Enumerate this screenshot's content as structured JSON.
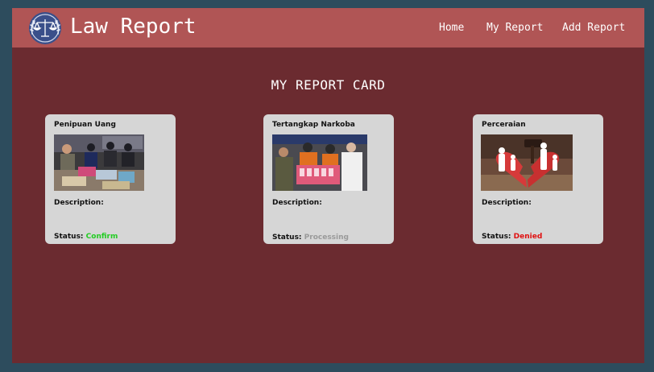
{
  "header": {
    "brand": "Law Report",
    "nav": {
      "home": "Home",
      "my_report": "My Report",
      "add_report": "Add Report"
    }
  },
  "main": {
    "title": "MY REPORT CARD",
    "cards": [
      {
        "title": "Penipuan Uang",
        "description_label": "Description:",
        "status_label": "Status:",
        "status": "Confirm"
      },
      {
        "title": "Tertangkap Narkoba",
        "description_label": "Description:",
        "status_label": "Status:",
        "status": "Processing"
      },
      {
        "title": "Perceraian",
        "description_label": "Description:",
        "status_label": "Status:",
        "status": "Denied"
      }
    ]
  },
  "colors": {
    "page_bg": "#2d4c5d",
    "content_bg": "#6b2b30",
    "navbar_bg": "#b05555",
    "card_bg": "#d6d6d6",
    "status_confirm": "#22cc22",
    "status_processing": "#9a9a9a",
    "status_denied": "#e01010"
  },
  "icons": {
    "logo": "scales-of-justice-laurel-icon"
  }
}
